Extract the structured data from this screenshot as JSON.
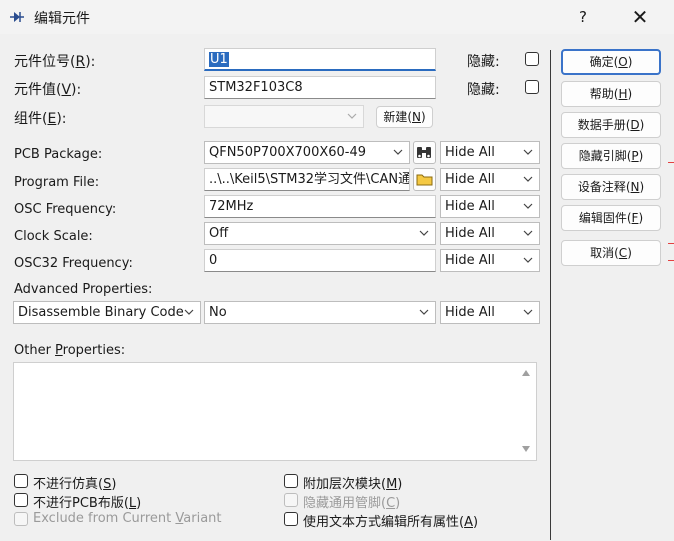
{
  "window": {
    "title": "编辑元件",
    "help": "?",
    "close": "✕"
  },
  "fields": {
    "ref_label": "元件位号(",
    "ref_key": "R",
    "ref_label_end": "):",
    "ref_value": "U1",
    "ref_hidden_label": "隐藏:",
    "value_label": "元件值(",
    "value_key": "V",
    "value_label_end": "):",
    "value_value": "STM32F103C8",
    "value_hidden_label": "隐藏:",
    "group_label": "组件(",
    "group_key": "E",
    "group_label_end": "):",
    "group_new_button": "新建(",
    "group_new_key": "N",
    "group_new_end": ")"
  },
  "properties": [
    {
      "label": "PCB Package:",
      "value": "QFN50P700X700X60-49",
      "visibility": "Hide All"
    },
    {
      "label": "Program File:",
      "value": "..\\..\\Keil5\\STM32学习文件\\CAN通",
      "visibility": "Hide All"
    },
    {
      "label": "OSC Frequency:",
      "value": "72MHz",
      "visibility": "Hide All"
    },
    {
      "label": "Clock Scale:",
      "value": "Off",
      "visibility": "Hide All"
    },
    {
      "label": "OSC32 Frequency:",
      "value": "0",
      "visibility": "Hide All"
    }
  ],
  "advanced": {
    "label": "Advanced Properties:",
    "property": "Disassemble Binary Code",
    "value": "No",
    "visibility": "Hide All"
  },
  "other": {
    "label_pre": "Other ",
    "label_key": "P",
    "label_post": "roperties:",
    "text": ""
  },
  "checkboxes": {
    "no_sim_pre": "不进行仿真(",
    "no_sim_key": "S",
    "no_sim_end": ")",
    "no_pcb_pre": "不进行PCB布版(",
    "no_pcb_key": "L",
    "no_pcb_end": ")",
    "exclude_pre": "Exclude from Current ",
    "exclude_key": "V",
    "exclude_post": "ariant",
    "attach_pre": "附加层次模块(",
    "attach_key": "M",
    "attach_end": ")",
    "hide_pins_pre": "隐藏通用管脚(",
    "hide_pins_key": "C",
    "hide_pins_end": ")",
    "edit_text_pre": "使用文本方式编辑所有属性(",
    "edit_text_key": "A",
    "edit_text_end": ")"
  },
  "buttons": [
    {
      "pre": "确定(",
      "key": "O",
      "end": ")"
    },
    {
      "pre": "帮助(",
      "key": "H",
      "end": ")"
    },
    {
      "pre": "数据手册(",
      "key": "D",
      "end": ")"
    },
    {
      "pre": "隐藏引脚(",
      "key": "P",
      "end": ")"
    },
    {
      "pre": "设备注释(",
      "key": "N",
      "end": ")"
    },
    {
      "pre": "编辑固件(",
      "key": "F",
      "end": ")"
    },
    {
      "pre": "取消(",
      "key": "C",
      "end": ")"
    }
  ]
}
